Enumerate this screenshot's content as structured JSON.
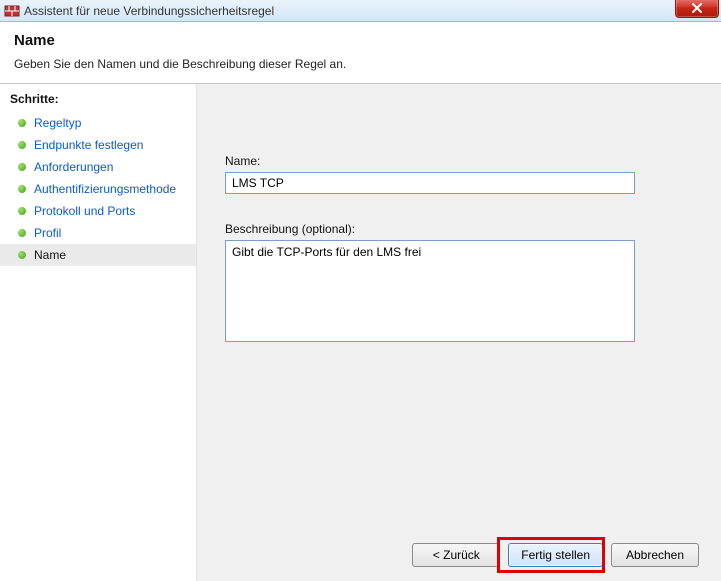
{
  "titlebar": {
    "title": "Assistent für neue Verbindungssicherheitsregel"
  },
  "header": {
    "title": "Name",
    "subtitle": "Geben Sie den Namen und die Beschreibung dieser Regel an."
  },
  "sidebar": {
    "heading": "Schritte:",
    "items": [
      {
        "label": "Regeltyp",
        "active": false
      },
      {
        "label": "Endpunkte festlegen",
        "active": false
      },
      {
        "label": "Anforderungen",
        "active": false
      },
      {
        "label": "Authentifizierungsmethode",
        "active": false
      },
      {
        "label": "Protokoll und Ports",
        "active": false
      },
      {
        "label": "Profil",
        "active": false
      },
      {
        "label": "Name",
        "active": true
      }
    ]
  },
  "form": {
    "name_label": "Name:",
    "name_value": "LMS TCP",
    "desc_label": "Beschreibung (optional):",
    "desc_value": "Gibt die TCP-Ports für den LMS frei"
  },
  "buttons": {
    "back": "< Zurück",
    "finish": "Fertig stellen",
    "cancel": "Abbrechen"
  }
}
